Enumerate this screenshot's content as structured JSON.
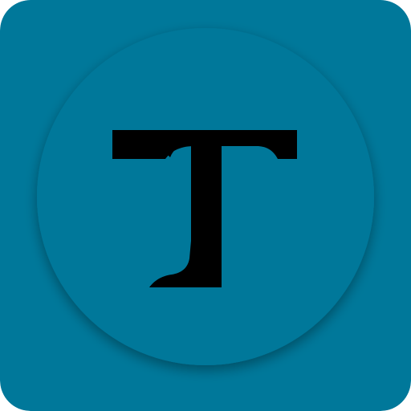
{
  "icon": {
    "name": "T",
    "letter": "T",
    "colors": {
      "background": "#00789A",
      "circle": "#00789A",
      "circle_shadow": "#005f7b",
      "glyph": "#000000"
    }
  }
}
